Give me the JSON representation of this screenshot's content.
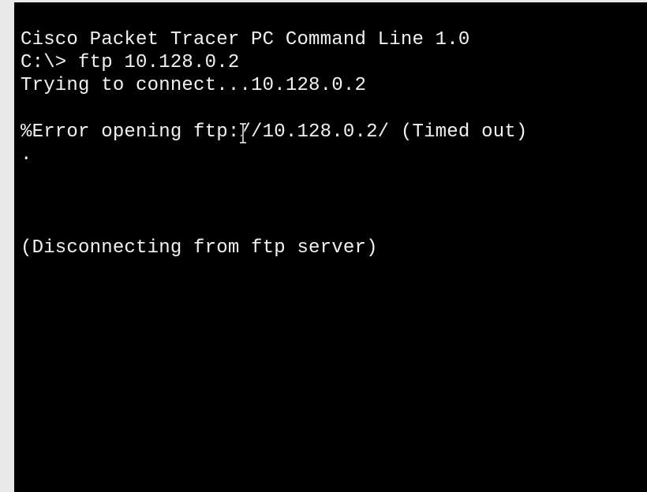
{
  "terminal": {
    "lines": {
      "l1": "Cisco Packet Tracer PC Command Line 1.0",
      "l2": "C:\\> ftp 10.128.0.2",
      "l3": "Trying to connect...10.128.0.2",
      "l4": "%Error opening ftp://10.128.0.2/ (Timed out)",
      "l5": ".",
      "l6": "(Disconnecting from ftp server)"
    },
    "background_color": "#000000",
    "text_color": "#f2f2f2"
  },
  "mouse_cursor": {
    "icon": "text-ibeam-cursor-icon"
  }
}
